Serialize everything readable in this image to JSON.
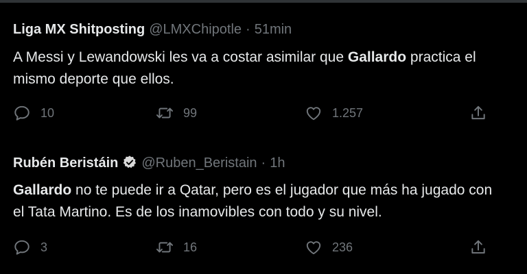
{
  "tweets": [
    {
      "display_name": "Liga MX Shitposting",
      "handle": "@LMXChipotle",
      "separator": "·",
      "time": "51min",
      "verified": false,
      "text_line1": [
        "A Messi y Lewandowski les va a costar asimilar que ",
        "Gallardo",
        " practica el"
      ],
      "text_line2": [
        "mismo deporte que ellos."
      ],
      "replies": "10",
      "retweets": "99",
      "likes": "1.257"
    },
    {
      "display_name": "Rubén Beristáin",
      "handle": "@Ruben_Beristain",
      "separator": "·",
      "time": "1h",
      "verified": true,
      "text_line1": [
        "Gallardo",
        " no te puede ir a Qatar, pero es el jugador que más ha jugado con"
      ],
      "text_line2": [
        "el Tata Martino. Es de los inamovibles con todo y su nivel."
      ],
      "replies": "3",
      "retweets": "16",
      "likes": "236"
    }
  ],
  "colors": {
    "background": "#000000",
    "text": "#e7e9ea",
    "secondary": "#71767b",
    "divider": "#2f3336"
  },
  "icons": {
    "reply": "reply-bubble-icon",
    "retweet": "retweet-arrows-icon",
    "like": "heart-outline-icon",
    "share": "share-upload-icon",
    "verified": "verified-badge-icon"
  }
}
